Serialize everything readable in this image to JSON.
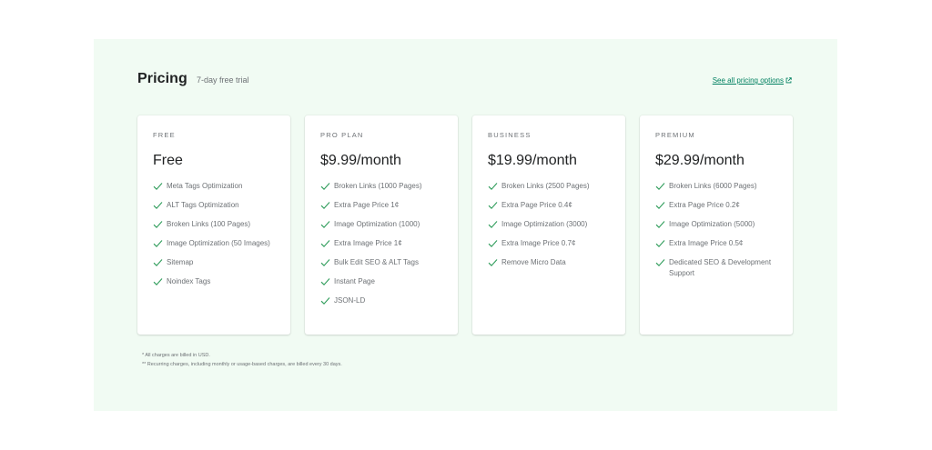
{
  "header": {
    "title": "Pricing",
    "subtitle": "7-day free trial",
    "link_label": "See all pricing options"
  },
  "colors": {
    "panel_bg": "#f1fbf3",
    "accent": "#008060",
    "check": "#2e9c5a"
  },
  "icons": {
    "feature": "checkmark-icon",
    "link": "external-link-icon"
  },
  "plans": [
    {
      "label": "FREE",
      "price": "Free",
      "features": [
        "Meta Tags Optimization",
        "ALT Tags Optimization",
        "Broken Links (100 Pages)",
        "Image Optimization (50 Images)",
        "Sitemap",
        "Noindex Tags"
      ]
    },
    {
      "label": "PRO PLAN",
      "price": "$9.99/month",
      "features": [
        "Broken Links (1000 Pages)",
        "Extra Page Price 1¢",
        "Image Optimization (1000)",
        "Extra Image Price 1¢",
        "Bulk Edit SEO & ALT Tags",
        "Instant Page",
        "JSON-LD"
      ]
    },
    {
      "label": "BUSINESS",
      "price": "$19.99/month",
      "features": [
        "Broken Links (2500 Pages)",
        "Extra Page Price 0.4¢",
        "Image Optimization (3000)",
        "Extra Image Price 0.7¢",
        "Remove Micro Data"
      ]
    },
    {
      "label": "PREMIUM",
      "price": "$29.99/month",
      "features": [
        "Broken Links (6000 Pages)",
        "Extra Page Price 0.2¢",
        "Image Optimization (5000)",
        "Extra Image Price 0.5¢",
        "Dedicated SEO & Development Support"
      ]
    }
  ],
  "notes": [
    "* All charges are billed in USD.",
    "** Recurring charges, including monthly or usage-based charges, are billed every 30 days."
  ]
}
